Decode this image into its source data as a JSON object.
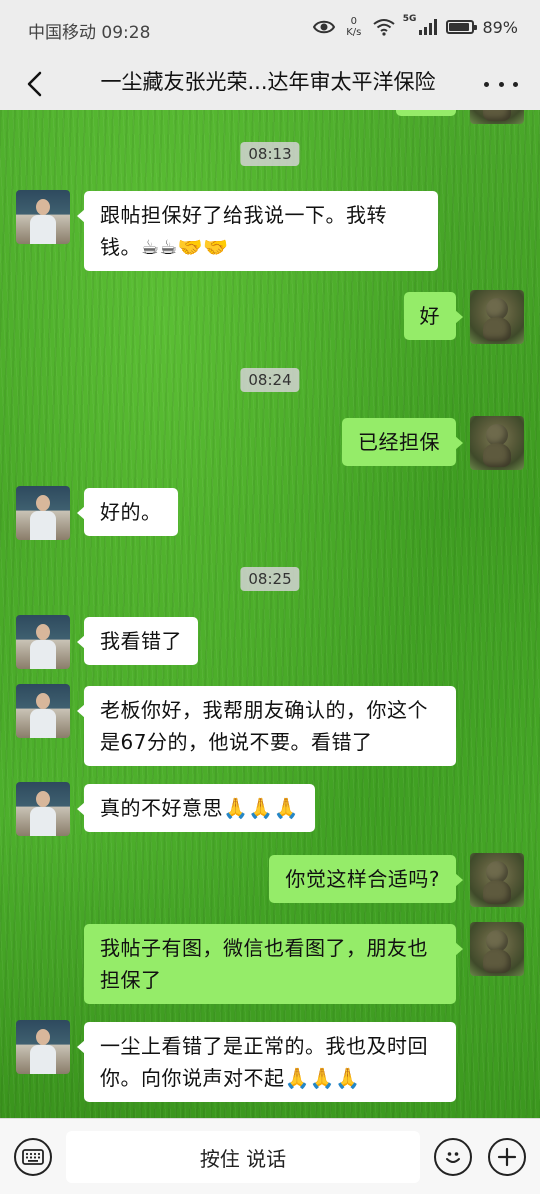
{
  "status_bar": {
    "carrier_time": "中国移动 09:28",
    "net_speed_value": "0",
    "net_speed_unit": "K/s",
    "network": "5G",
    "battery": "89%"
  },
  "header": {
    "title": "一尘藏友张光荣...达年审太平洋保险"
  },
  "messages": [
    {
      "kind": "time",
      "text": "08:13"
    },
    {
      "kind": "msg",
      "side": "other",
      "text": "跟帖担保好了给我说一下。我转钱。☕☕🤝🤝"
    },
    {
      "kind": "msg",
      "side": "self",
      "text": "好"
    },
    {
      "kind": "time",
      "text": "08:24"
    },
    {
      "kind": "msg",
      "side": "self",
      "text": "已经担保"
    },
    {
      "kind": "msg",
      "side": "other",
      "text": "好的。"
    },
    {
      "kind": "time",
      "text": "08:25"
    },
    {
      "kind": "msg",
      "side": "other",
      "text": "我看错了"
    },
    {
      "kind": "msg",
      "side": "other",
      "text": "老板你好，我帮朋友确认的，你这个是67分的，他说不要。看错了"
    },
    {
      "kind": "msg",
      "side": "other",
      "text": "真的不好意思🙏🙏🙏"
    },
    {
      "kind": "msg",
      "side": "self",
      "text": "你觉这样合适吗?"
    },
    {
      "kind": "msg",
      "side": "self",
      "text": "我帖子有图，微信也看图了，朋友也担保了"
    },
    {
      "kind": "msg",
      "side": "other",
      "text": "一尘上看错了是正常的。我也及时回你。向你说声对不起🙏🙏🙏"
    }
  ],
  "input_bar": {
    "hold_to_talk_label": "按住 说话"
  }
}
